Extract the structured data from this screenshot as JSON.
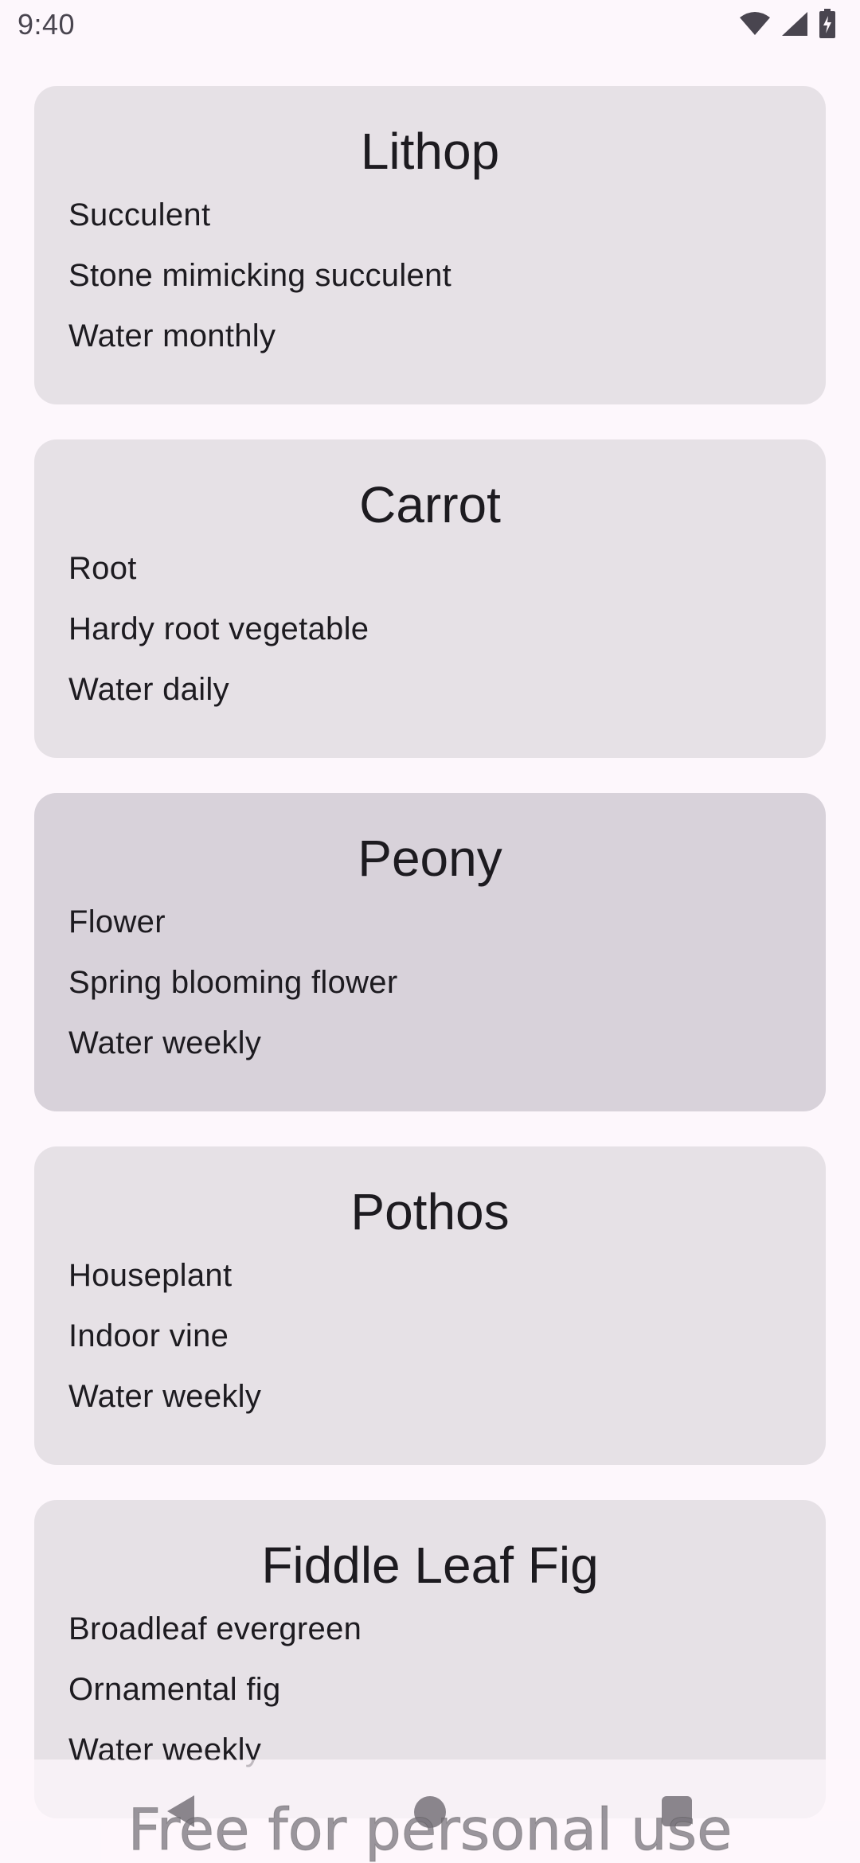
{
  "status_bar": {
    "time": "9:40",
    "icons": [
      "wifi-icon",
      "signal-icon",
      "battery-charging-icon"
    ]
  },
  "plants": [
    {
      "name": "Lithop",
      "type": "Succulent",
      "description": "Stone mimicking succulent",
      "watering": "Water monthly"
    },
    {
      "name": "Carrot",
      "type": "Root",
      "description": "Hardy root vegetable",
      "watering": "Water daily"
    },
    {
      "name": "Peony",
      "type": "Flower",
      "description": "Spring blooming flower",
      "watering": "Water weekly"
    },
    {
      "name": "Pothos",
      "type": "Houseplant",
      "description": "Indoor vine",
      "watering": "Water weekly"
    },
    {
      "name": "Fiddle Leaf Fig",
      "type": "Broadleaf evergreen",
      "description": "Ornamental fig",
      "watering": "Water weekly"
    }
  ],
  "navigation_bar": {
    "icons": [
      "back-icon",
      "home-icon",
      "recents-icon"
    ]
  },
  "watermark": "Free for personal use",
  "colors": {
    "background": "#fdf7fc",
    "card": "#e6e1e6",
    "card_pressed": "#d8d2da",
    "text": "#1d1b20"
  }
}
